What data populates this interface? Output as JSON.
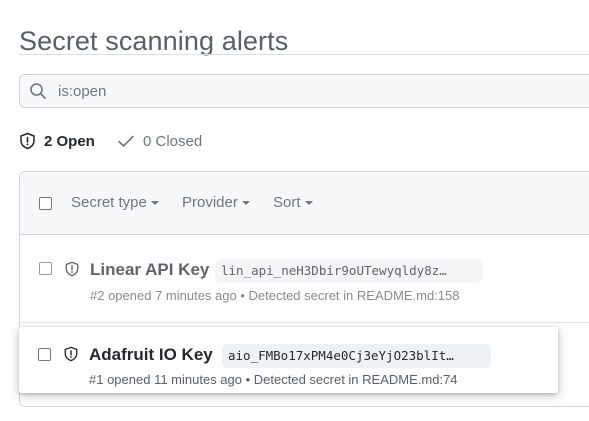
{
  "page": {
    "title": "Secret scanning alerts"
  },
  "search": {
    "value": "is:open"
  },
  "tabs": {
    "open": {
      "label": "2 Open"
    },
    "closed": {
      "label": "0 Closed"
    }
  },
  "filters": {
    "secret_type": "Secret type",
    "provider": "Provider",
    "sort": "Sort"
  },
  "alerts": [
    {
      "title": "Linear API Key",
      "token": "lin_api_neH3Dbir9oUTewyqldy8z…",
      "meta": "#2 opened 7 minutes ago • Detected secret in README.md:158"
    },
    {
      "title": "Adafruit IO Key",
      "token": "aio_FMBo17xPM4e0Cj3eYjO23blIt…",
      "meta": "#1 opened 11 minutes ago • Detected secret in README.md:74"
    }
  ],
  "colors": {
    "title_muted": "#57606a",
    "text": "#24292f",
    "muted": "#6e7781",
    "border": "#d0d7de",
    "subtle_bg": "#f6f8fa"
  },
  "icons": [
    "search-icon",
    "shield-icon",
    "check-icon",
    "caret-down-icon"
  ]
}
